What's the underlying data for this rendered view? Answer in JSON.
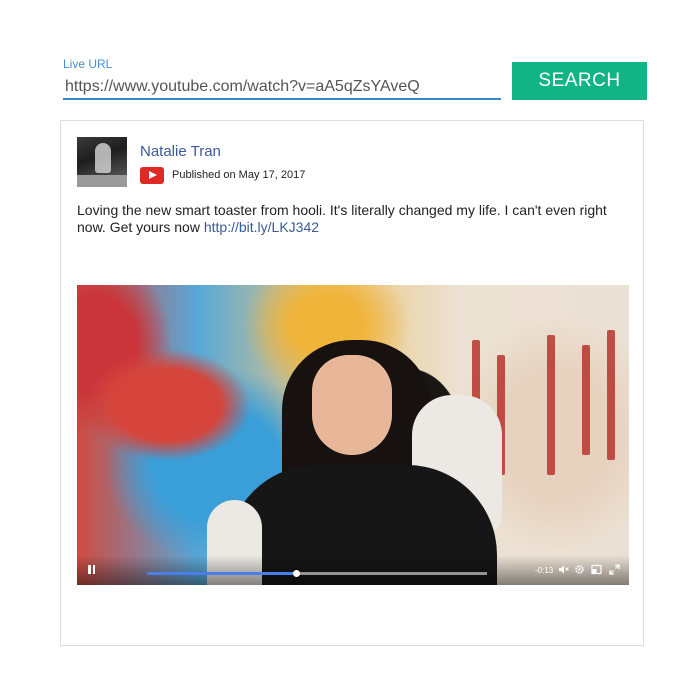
{
  "search": {
    "label": "Live URL",
    "value": "https://www.youtube.com/watch?v=aA5qZsYAveQ",
    "button_label": "SEARCH"
  },
  "post": {
    "author": "Natalie Tran",
    "source_icon": "youtube-icon",
    "published": "Published on May 17, 2017",
    "text": "Loving the new smart toaster from hooli. It's literally changed my life. I can't even right now. Get yours now ",
    "link": "http://bit.ly/LKJ342"
  },
  "player": {
    "time_remaining": "-0:13",
    "progress": 0.44,
    "icons": [
      "pause-icon",
      "mute-icon",
      "settings-icon",
      "popout-icon",
      "fullscreen-icon"
    ]
  },
  "colors": {
    "accent": "#12b486",
    "link": "#3b5998",
    "input_underline": "#3a86c8",
    "label": "#4a8fd0",
    "youtube_red": "#dd2a26",
    "progress": "#4a7ee8"
  }
}
